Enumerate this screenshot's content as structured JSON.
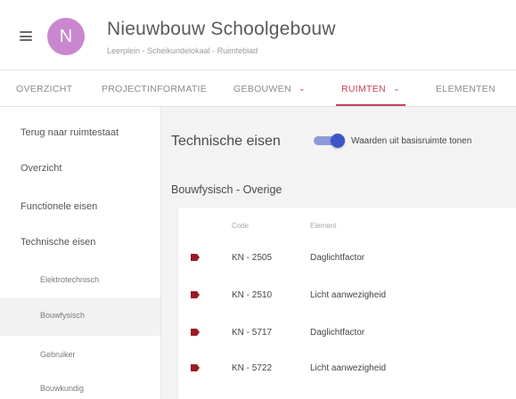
{
  "header": {
    "avatar_letter": "N",
    "avatar_color": "#c987cf",
    "title": "Nieuwbouw Schoolgebouw",
    "breadcrumb": "Leerplein - Scheikundelokaal - Ruimteblad"
  },
  "tabs": [
    {
      "label": "OVERZICHT"
    },
    {
      "label": "PROJECTINFORMATIE"
    },
    {
      "label": "GEBOUWEN",
      "chevron": "⌄"
    },
    {
      "label": "RUIMTEN",
      "chevron": "⌄",
      "active": true
    },
    {
      "label": "ELEMENTEN"
    }
  ],
  "accent_color": "#c5405a",
  "sidebar": {
    "items": [
      {
        "label": "Terug naar ruimtestaat"
      },
      {
        "label": "Overzicht"
      },
      {
        "label": "Functionele eisen"
      },
      {
        "label": "Technische eisen"
      },
      {
        "label": "Elektrotechnisch"
      },
      {
        "label": "Bouwfysisch",
        "selected": true
      },
      {
        "label": "Gebruiker"
      },
      {
        "label": "Bouwkundig"
      }
    ]
  },
  "main": {
    "section_title": "Technische eisen",
    "toggle": {
      "label": "Waarden uit basisruimte tonen",
      "on": true
    },
    "subsection": "Bouwfysisch - Overige",
    "table": {
      "columns": [
        "Code",
        "Element"
      ],
      "marker_color": "#9b1a24",
      "rows": [
        {
          "code": "KN - 2505",
          "element": "Daglichtfactor"
        },
        {
          "code": "KN - 2510",
          "element": "Licht aanwezigheid"
        },
        {
          "code": "KN - 5717",
          "element": "Daglichtfactor"
        },
        {
          "code": "KN - 5722",
          "element": "Licht aanwezigheid"
        }
      ]
    }
  }
}
